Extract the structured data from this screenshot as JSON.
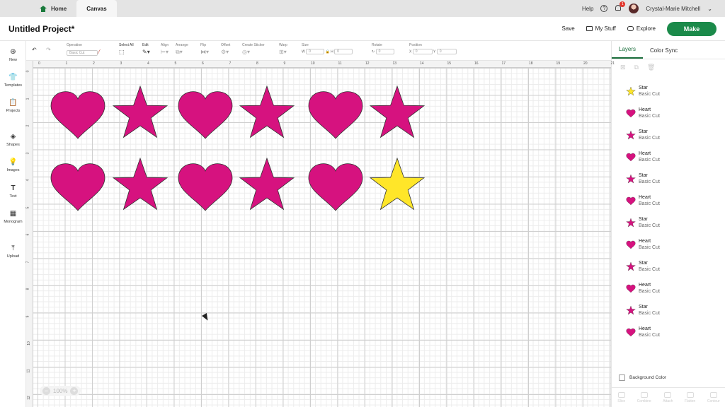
{
  "topbar": {
    "home_label": "Home",
    "canvas_tab": "Canvas",
    "help_label": "Help",
    "notification_count": "1",
    "user_name": "Crystal-Marie Mitchell"
  },
  "header": {
    "project_title": "Untitled Project*",
    "save_label": "Save",
    "mystuff_label": "My Stuff",
    "explore_label": "Explore",
    "make_label": "Make"
  },
  "leftbar": {
    "items": [
      {
        "label": "New"
      },
      {
        "label": "Templates"
      },
      {
        "label": "Projects"
      },
      {
        "label": "Shapes"
      },
      {
        "label": "Images"
      },
      {
        "label": "Text"
      },
      {
        "label": "Monogram"
      },
      {
        "label": "Upload"
      }
    ]
  },
  "toolbar": {
    "operation_label": "Operation",
    "operation_value": "Basic Cut",
    "select_all_label": "Select All",
    "edit_label": "Edit",
    "align_label": "Align",
    "arrange_label": "Arrange",
    "flip_label": "Flip",
    "offset_label": "Offset",
    "create_sticker_label": "Create Sticker",
    "warp_label": "Warp",
    "size_label": "Size",
    "size_w_label": "W",
    "size_w_value": "0",
    "size_h_label": "H",
    "size_h_value": "0",
    "rotate_label": "Rotate",
    "rotate_value": "0",
    "position_label": "Position",
    "pos_x_label": "X",
    "pos_x_value": "0",
    "pos_y_label": "Y",
    "pos_y_value": "0"
  },
  "ruler": {
    "top": [
      "0",
      "1",
      "2",
      "3",
      "4",
      "5",
      "6",
      "7",
      "8",
      "9",
      "10",
      "11",
      "12",
      "13",
      "14",
      "15",
      "16",
      "17",
      "18",
      "19",
      "20",
      "21"
    ],
    "left": [
      "0",
      "1",
      "2",
      "3",
      "4",
      "5",
      "6",
      "7",
      "8",
      "9",
      "10",
      "11",
      "12"
    ]
  },
  "canvas": {
    "shapes": [
      {
        "type": "heart",
        "row": 0,
        "col": 0,
        "color": "#D6127F"
      },
      {
        "type": "star",
        "row": 0,
        "col": 1,
        "color": "#D6127F"
      },
      {
        "type": "heart",
        "row": 0,
        "col": 2,
        "color": "#D6127F"
      },
      {
        "type": "star",
        "row": 0,
        "col": 3,
        "color": "#D6127F"
      },
      {
        "type": "heart",
        "row": 0,
        "col": 4,
        "color": "#D6127F"
      },
      {
        "type": "star",
        "row": 0,
        "col": 5,
        "color": "#D6127F"
      },
      {
        "type": "heart",
        "row": 1,
        "col": 0,
        "color": "#D6127F"
      },
      {
        "type": "star",
        "row": 1,
        "col": 1,
        "color": "#D6127F"
      },
      {
        "type": "heart",
        "row": 1,
        "col": 2,
        "color": "#D6127F"
      },
      {
        "type": "star",
        "row": 1,
        "col": 3,
        "color": "#D6127F"
      },
      {
        "type": "heart",
        "row": 1,
        "col": 4,
        "color": "#D6127F"
      },
      {
        "type": "star",
        "row": 1,
        "col": 5,
        "color": "#FFE629"
      }
    ]
  },
  "zoom": {
    "value": "100%",
    "minus": "−",
    "plus": "+"
  },
  "panel": {
    "tab_layers": "Layers",
    "tab_color_sync": "Color Sync",
    "layers": [
      {
        "name": "Star",
        "op": "Basic Cut",
        "type": "star",
        "color": "#FFE629"
      },
      {
        "name": "Heart",
        "op": "Basic Cut",
        "type": "heart",
        "color": "#D6127F"
      },
      {
        "name": "Star",
        "op": "Basic Cut",
        "type": "star",
        "color": "#D6127F"
      },
      {
        "name": "Heart",
        "op": "Basic Cut",
        "type": "heart",
        "color": "#D6127F"
      },
      {
        "name": "Star",
        "op": "Basic Cut",
        "type": "star",
        "color": "#D6127F"
      },
      {
        "name": "Heart",
        "op": "Basic Cut",
        "type": "heart",
        "color": "#D6127F"
      },
      {
        "name": "Star",
        "op": "Basic Cut",
        "type": "star",
        "color": "#D6127F"
      },
      {
        "name": "Heart",
        "op": "Basic Cut",
        "type": "heart",
        "color": "#D6127F"
      },
      {
        "name": "Star",
        "op": "Basic Cut",
        "type": "star",
        "color": "#D6127F"
      },
      {
        "name": "Heart",
        "op": "Basic Cut",
        "type": "heart",
        "color": "#D6127F"
      },
      {
        "name": "Star",
        "op": "Basic Cut",
        "type": "star",
        "color": "#D6127F"
      },
      {
        "name": "Heart",
        "op": "Basic Cut",
        "type": "heart",
        "color": "#D6127F"
      }
    ],
    "background_color_label": "Background Color",
    "bottom_actions": [
      "Slice",
      "Combine",
      "Attach",
      "Flatten",
      "Contour"
    ]
  }
}
